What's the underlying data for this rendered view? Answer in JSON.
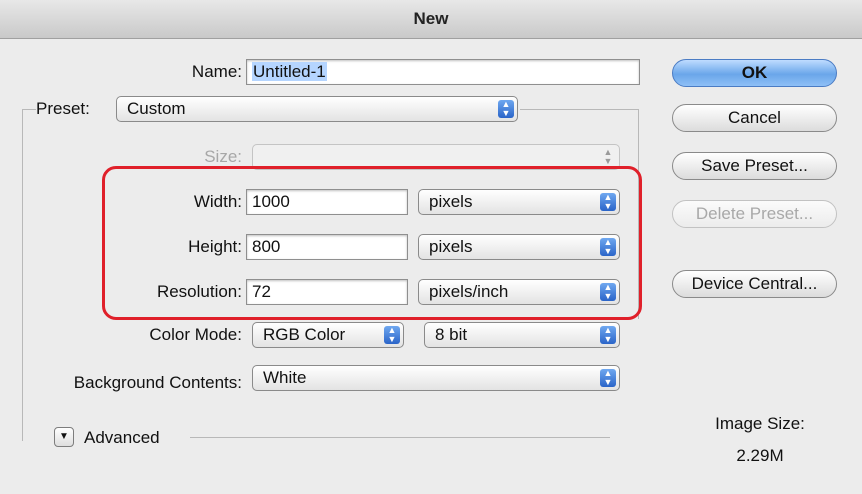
{
  "window": {
    "title": "New"
  },
  "form": {
    "name_label": "Name:",
    "name_value": "Untitled-1",
    "preset_label": "Preset:",
    "preset_value": "Custom",
    "size_label": "Size:",
    "size_value": "",
    "width_label": "Width:",
    "width_value": "1000",
    "width_unit": "pixels",
    "height_label": "Height:",
    "height_value": "800",
    "height_unit": "pixels",
    "resolution_label": "Resolution:",
    "resolution_value": "72",
    "resolution_unit": "pixels/inch",
    "color_mode_label": "Color Mode:",
    "color_mode_value": "RGB Color",
    "bit_depth_value": "8 bit",
    "background_label": "Background Contents:",
    "background_value": "White",
    "advanced_label": "Advanced"
  },
  "buttons": {
    "ok": "OK",
    "cancel": "Cancel",
    "save_preset": "Save Preset...",
    "delete_preset": "Delete Preset...",
    "device_central": "Device Central..."
  },
  "info": {
    "image_size_label": "Image Size:",
    "image_size_value": "2.29M"
  },
  "colors": {
    "highlight": "#e0202a",
    "accent": "#3a78d8"
  },
  "icons": {
    "select_arrow": "updown-chevron-icon",
    "disclosure": "disclosure-triangle-icon"
  }
}
